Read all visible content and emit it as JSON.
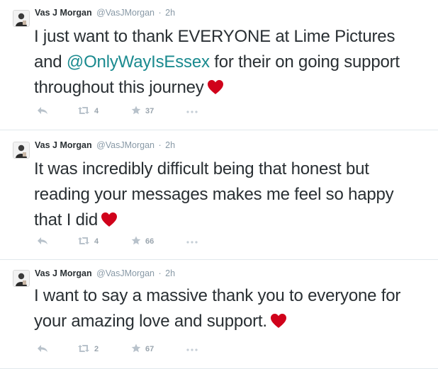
{
  "tweets": [
    {
      "name": "Vas J Morgan",
      "handle": "@VasJMorgan",
      "sep": "·",
      "time": "2h",
      "text_before": "I just want to thank EVERYONE at Lime Pictures and ",
      "mention": "@OnlyWayIsEssex",
      "text_after": " for their on going support throughout this journey",
      "retweets": "4",
      "favorites": "37"
    },
    {
      "name": "Vas J Morgan",
      "handle": "@VasJMorgan",
      "sep": "·",
      "time": "2h",
      "text": "It was incredibly difficult being that honest but reading your messages makes me feel so happy that I did",
      "retweets": "4",
      "favorites": "66"
    },
    {
      "name": "Vas J Morgan",
      "handle": "@VasJMorgan",
      "sep": "·",
      "time": "2h",
      "text": "I want to say a massive thank you to everyone for your amazing love and support.",
      "retweets": "2",
      "favorites": "67"
    }
  ],
  "icons": {
    "heart": "heart-icon",
    "reply": "reply-icon",
    "retweet": "retweet-icon",
    "favorite": "star-icon",
    "more": "more-icon"
  },
  "colors": {
    "heart": "#d0021b",
    "mention": "#1a8a8f",
    "meta": "#8899a6",
    "action": "#b8c2cb"
  }
}
